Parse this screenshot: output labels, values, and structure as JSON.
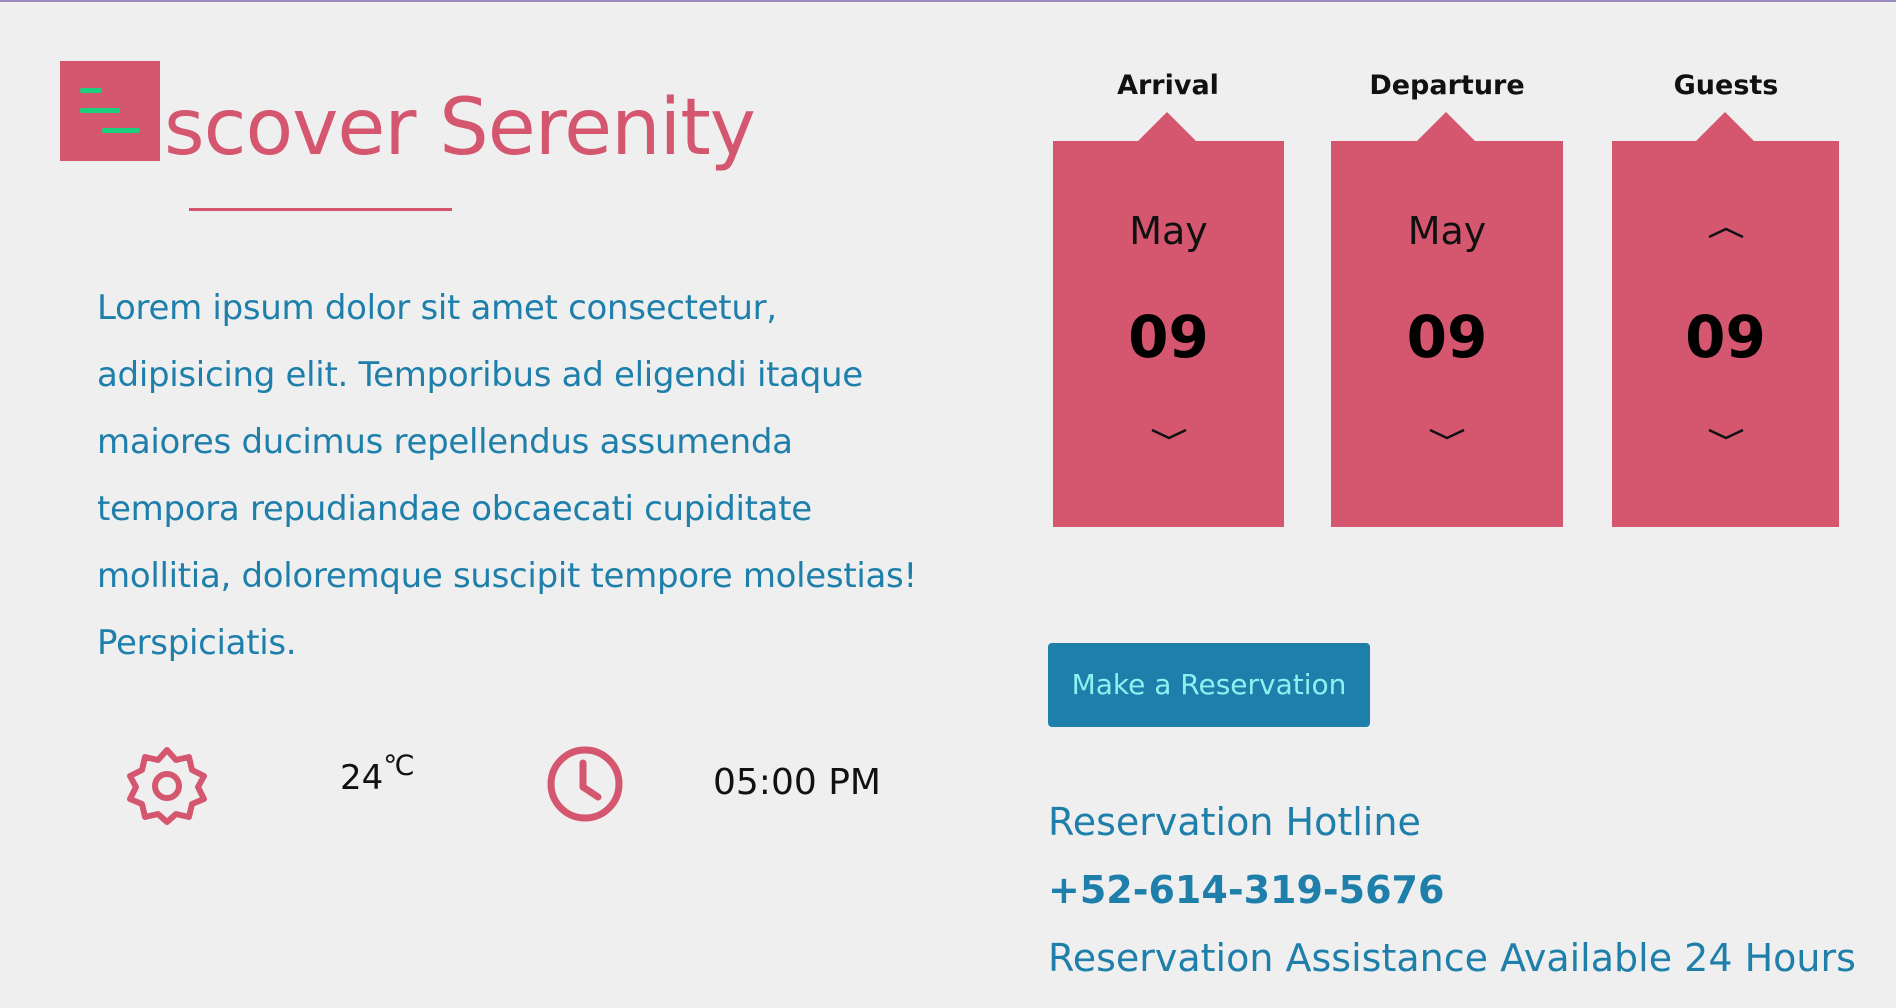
{
  "header": {
    "title": "scover Serenity",
    "menu_icon": "menu-icon"
  },
  "intro": {
    "text": "Lorem ipsum dolor sit amet consectetur, adipisicing elit. Temporibus ad eligendi itaque maiores ducimus repellendus assumenda tempora repudiandae obcaecati cupiditate mollitia, doloremque suscipit tempore molestias! Perspiciatis."
  },
  "weather": {
    "icon": "sun-icon",
    "temperature": "24",
    "unit": "℃"
  },
  "time": {
    "icon": "clock-icon",
    "value": "05:00 PM"
  },
  "booking": {
    "arrival": {
      "label": "Arrival",
      "month": "May",
      "day": "09"
    },
    "departure": {
      "label": "Departure",
      "month": "May",
      "day": "09"
    },
    "guests": {
      "label": "Guests",
      "count": "09"
    }
  },
  "reserve_button": "Make a Reservation",
  "hotline": {
    "label": "Reservation Hotline",
    "phone": "+52-614-319-5676",
    "note": "Reservation Assistance Available 24 Hours"
  },
  "colors": {
    "accent": "#d4566f",
    "text_blue": "#1e7fab",
    "menu_lines": "#1bd07c",
    "background": "#efefef"
  }
}
